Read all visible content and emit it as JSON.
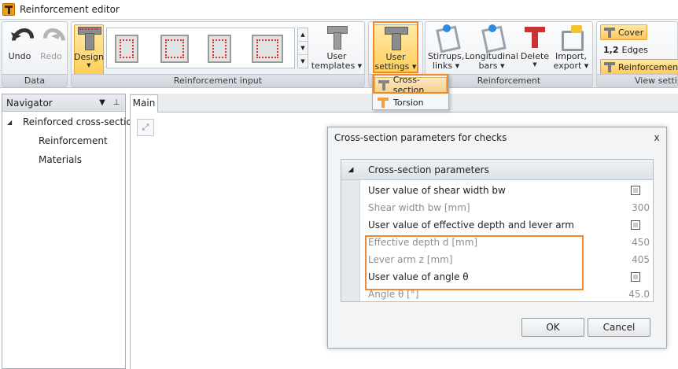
{
  "window": {
    "title": "Reinforcement editor"
  },
  "ribbon": {
    "data_group": {
      "label": "Data",
      "undo": "Undo",
      "redo": "Redo"
    },
    "reinforcement_input_group": {
      "label": "Reinforcement input",
      "design": "Design",
      "user_templates_line1": "User",
      "user_templates_line2": "templates"
    },
    "user_settings": {
      "line1": "User",
      "line2": "settings"
    },
    "reinforcement_group": {
      "label": "Reinforcement",
      "stirrups_line1": "Stirrups,",
      "stirrups_line2": "links",
      "longitudinal_line1": "Longitudinal",
      "longitudinal_line2": "bars",
      "delete": "Delete",
      "import_line1": "Import,",
      "import_line2": "export"
    },
    "view_group": {
      "label": "View setting",
      "cover": "Cover",
      "edges_prefix": "1,2",
      "edges": "Edges",
      "reinforcement": "Reinforcement"
    }
  },
  "dropdown": {
    "items": [
      "Cross-section",
      "Torsion"
    ]
  },
  "navigator": {
    "title": "Navigator",
    "root": "Reinforced cross-section",
    "children": [
      "Reinforcement",
      "Materials"
    ]
  },
  "main_tab": "Main",
  "dialog": {
    "title": "Cross-section parameters for checks",
    "close": "x",
    "section": "Cross-section parameters",
    "rows": [
      {
        "label": "User value of shear width bw",
        "type": "checkbox",
        "checked": false
      },
      {
        "label": "Shear width bw [mm]",
        "value": "300"
      },
      {
        "label": "User value of effective depth and lever arm",
        "type": "checkbox",
        "checked": false
      },
      {
        "label": "Effective depth d [mm]",
        "value": "450"
      },
      {
        "label": "Lever arm z [mm]",
        "value": "405"
      },
      {
        "label": "User value of angle θ",
        "type": "checkbox",
        "checked": false
      },
      {
        "label": "Angle θ [°]",
        "value": "45.0"
      }
    ],
    "ok": "OK",
    "cancel": "Cancel"
  },
  "colors": {
    "highlight_outline": "#ee8a2d",
    "active_button": "#ffcf5a",
    "ribbon_bg": "#e3e7eb"
  }
}
